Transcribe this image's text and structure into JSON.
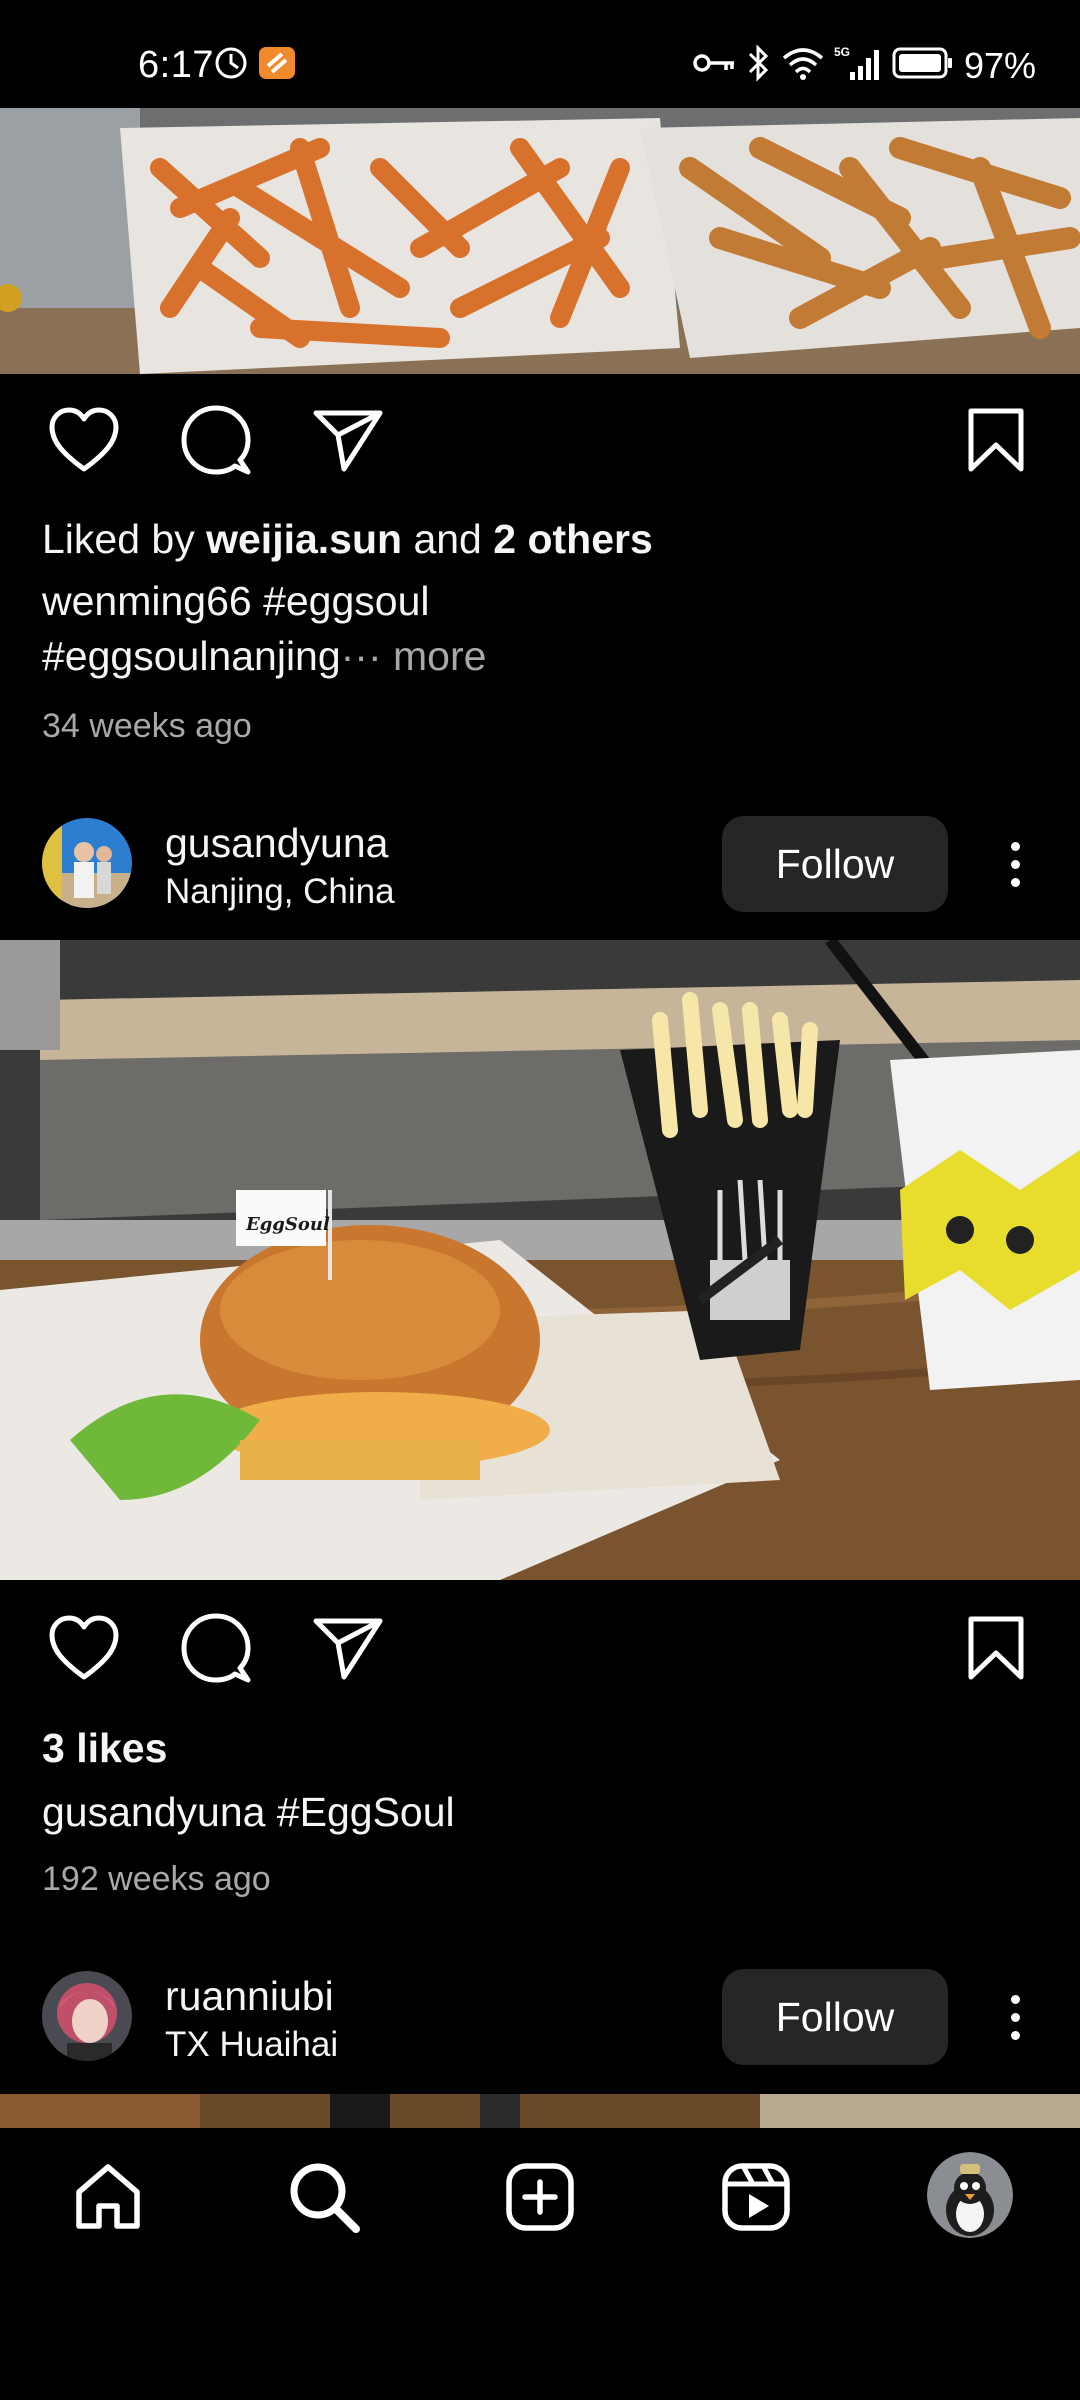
{
  "status_bar": {
    "time": "6:17",
    "battery": "97%",
    "network": "5G",
    "icons": [
      "timer-icon",
      "app-notification-icon",
      "key-icon",
      "bluetooth-icon",
      "wifi-icon",
      "signal-icon",
      "battery-icon"
    ]
  },
  "posts": [
    {
      "liked_by_prefix": "Liked by ",
      "liked_by_user": "weijia.sun",
      "liked_by_mid": " and ",
      "liked_by_others": "2 others",
      "caption_user": "wenming66",
      "caption_line1_tag": " #eggsoul",
      "caption_line2": "#eggsoulnanjing",
      "caption_ellipsis": "··· ",
      "more": "more",
      "time_ago": "34 weeks ago"
    },
    {
      "username": "gusandyuna",
      "location": "Nanjing, China",
      "follow_label": "Follow",
      "likes": "3 likes",
      "caption_user": "gusandyuna",
      "caption_text": " #EggSoul",
      "time_ago": "192 weeks ago"
    },
    {
      "username": "ruanniubi",
      "location": "TX Huaihai",
      "follow_label": "Follow"
    }
  ],
  "bottom_nav": {
    "items": [
      "home-icon",
      "search-icon",
      "create-icon",
      "reels-icon",
      "profile-avatar"
    ]
  },
  "colors": {
    "background": "#000000",
    "button_bg": "#262626",
    "muted_text": "#a8a8a8"
  }
}
